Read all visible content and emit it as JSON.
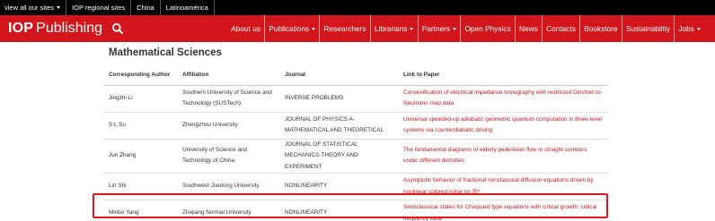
{
  "topbar": {
    "items": [
      {
        "label": "view all our sites"
      },
      {
        "label": "IOP regional sites"
      },
      {
        "label": "China"
      },
      {
        "label": "Latinoamérica"
      }
    ]
  },
  "header": {
    "logo_bold": "IOP",
    "logo_rest": "Publishing",
    "nav": [
      {
        "label": "About us"
      },
      {
        "label": "Publications"
      },
      {
        "label": "Researchers"
      },
      {
        "label": "Librarians"
      },
      {
        "label": "Partners"
      },
      {
        "label": "Open Physics"
      },
      {
        "label": "News"
      },
      {
        "label": "Contacts"
      },
      {
        "label": "Bookstore"
      },
      {
        "label": "Sustainability"
      },
      {
        "label": "Jobs"
      }
    ]
  },
  "main": {
    "title": "Mathematical Sciences",
    "table": {
      "headers": [
        "Corresponding Author",
        "Affiliation",
        "Journal",
        "Link to Paper"
      ],
      "rows": [
        {
          "author": "Jingzhi Li",
          "affiliation": "Southern University of Science and Technology (SUSTech)",
          "journal": "INVERSE PROBLEMS",
          "link": "Convexification of electrical impedance tomography with restricted Dirichlet-to-Neumann map data"
        },
        {
          "author": "S L Su",
          "affiliation": "Zhengzhou University",
          "journal": "JOURNAL OF PHYSICS A-MATHEMATICAL AND THEORETICAL",
          "link": "Universal speeded-up adiabatic geometric quantum computation in three-level systems via counterdiabatic driving"
        },
        {
          "author": "Jun Zhang",
          "affiliation": "University of Science and Technology of China",
          "journal": "JOURNAL OF STATISTICAL MECHANICS-THEORY AND EXPERIMENT",
          "link": "The fundamental diagrams of elderly pedestrian flow in straight corridors under different densities"
        },
        {
          "author": "Lin Shi",
          "affiliation": "Southwest Jiaotong University",
          "journal": "NONLINEARITY",
          "link": "Asymptotic behavior of fractional nonclassical diffusion equations driven by nonlinear colored noise on ℝᴺ"
        },
        {
          "author": "Minbo Yang",
          "affiliation": "Zhejiang Normal University",
          "journal": "NONLINEARITY",
          "link": "Semiclassical states for Choquard type equations with critical growth: critical frequency case"
        }
      ]
    }
  },
  "colors": {
    "brand_red": "#d3161b",
    "highlight_red": "#e4161b",
    "topbar_black": "#000000"
  }
}
